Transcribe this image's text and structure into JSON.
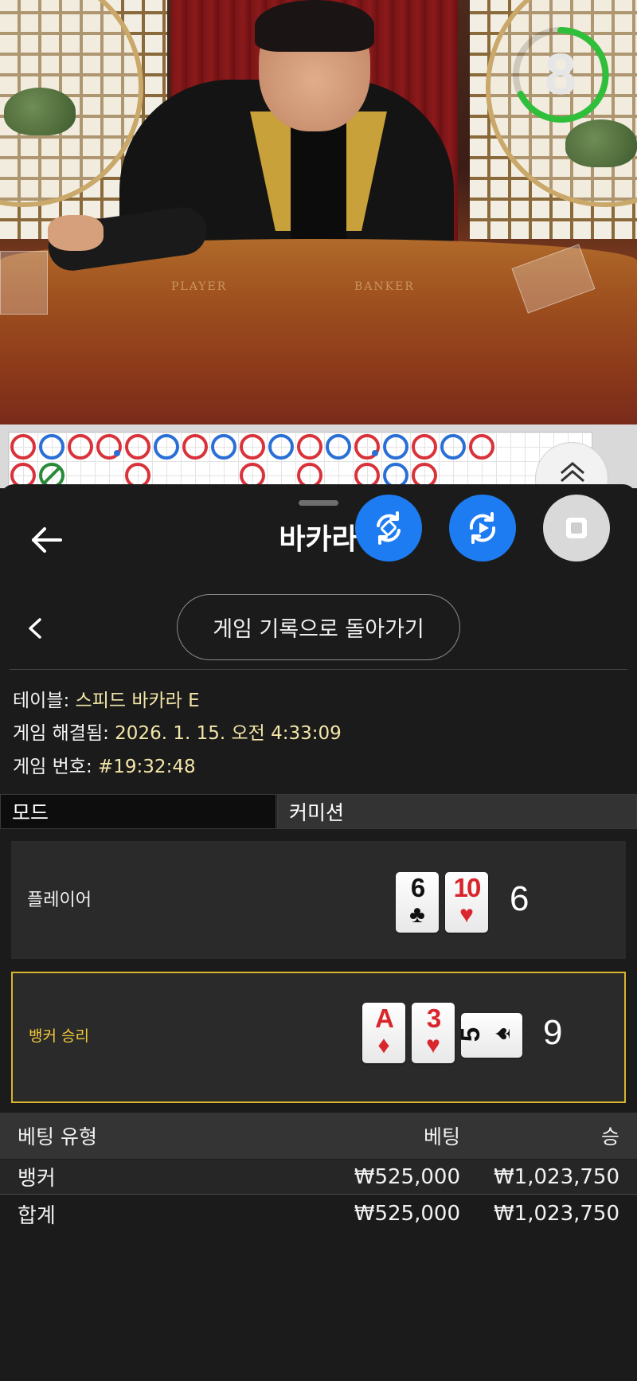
{
  "video": {
    "countdown": "8",
    "felt_labels": [
      "PLAYER",
      "BANKER"
    ]
  },
  "header": {
    "title": "바카라"
  },
  "history_button_label": "게임 기록으로 돌아가기",
  "game_info": {
    "table_label": "테이블: ",
    "table_value": "스피드 바카라 E",
    "resolved_label": "게임 해결됨: ",
    "resolved_value": "2026. 1. 15. 오전 4:33:09",
    "number_label": "게임 번호: ",
    "number_value": "#19:32:48"
  },
  "mode": {
    "label": "모드",
    "value": "커미션"
  },
  "player": {
    "label": "플레이어",
    "score": "6",
    "cards": [
      {
        "rank": "6",
        "suit": "♣",
        "color": "black"
      },
      {
        "rank": "10",
        "suit": "♥",
        "color": "red"
      }
    ]
  },
  "banker": {
    "label": "뱅커 승리",
    "score": "9",
    "cards": [
      {
        "rank": "A",
        "suit": "♦",
        "color": "red"
      },
      {
        "rank": "3",
        "suit": "♥",
        "color": "red"
      },
      {
        "rank": "5",
        "suit": "♠",
        "color": "black"
      }
    ]
  },
  "bets_table": {
    "headers": [
      "베팅 유형",
      "베팅",
      "승"
    ],
    "rows": [
      {
        "type": "뱅커",
        "bet": "₩525,000",
        "win": "₩1,023,750"
      }
    ],
    "total": {
      "type": "합계",
      "bet": "₩525,000",
      "win": "₩1,023,750"
    }
  },
  "colors": {
    "accent_blue": "#1e7cf2",
    "winner_gold": "#d8b52a",
    "info_value": "#f3e6a8",
    "timer_green": "#2fbf3a"
  },
  "bead_road": {
    "row1": [
      "B",
      "P",
      "B",
      "B-dot",
      "B",
      "P",
      "B",
      "P",
      "B",
      "P",
      "B",
      "P",
      "B-dot",
      "P",
      "B",
      "P",
      "B"
    ],
    "row2": [
      "B",
      "T",
      "",
      "",
      "B",
      "",
      "",
      "",
      "B",
      "",
      "B",
      "",
      "B",
      "P",
      "B",
      "",
      ""
    ]
  }
}
